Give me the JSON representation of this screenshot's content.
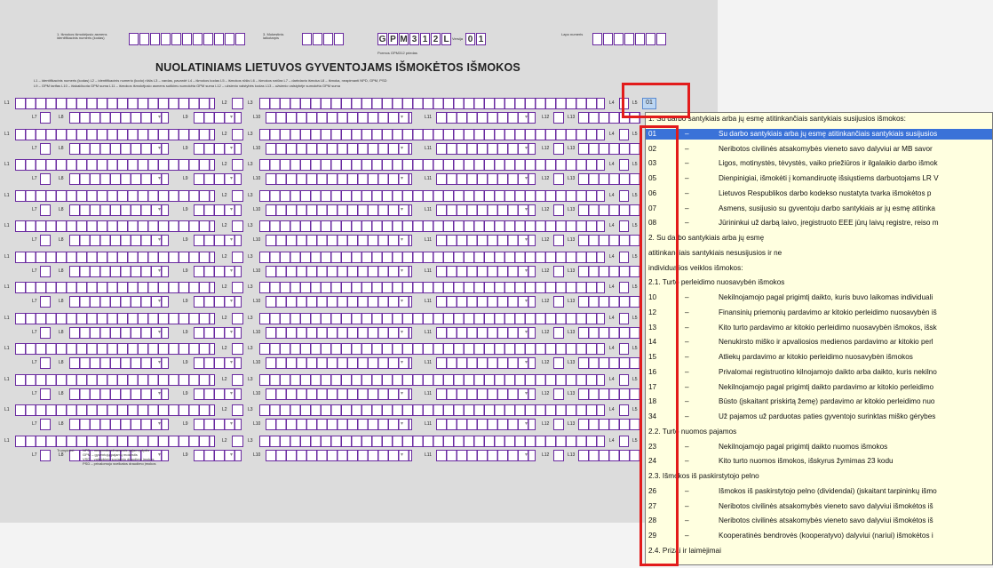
{
  "header": {
    "field1_label": "1. Išmokos išmokėjusio asmens identifikacinis numeris (kodas)",
    "field2_label": "3. Mokestinis laikotarpis",
    "form_code": [
      "G",
      "P",
      "M",
      "3",
      "1",
      "2",
      "L"
    ],
    "version_label": "Versija",
    "version_value": [
      "0",
      "1"
    ],
    "form_subtitle": "Pormos GPM312 priedas",
    "page_label": "Lapo numeris",
    "title": "NUOLATINIAMS LIETUVOS GYVENTOJAMS IŠMOKĖTOS IŠMOKOS",
    "legend_line1": "L1 – identifikacinis numeris (kodas)  L2 – identifikacinis numerio (kodo) rūšis  L3 – vardas, pavardė  L4 – išmokos kodas  L5 – išmokos rūšis  L6 – išmokos natūra  L7 – darbdavio išmoka  L8 – išmoka, neapimanti NPD, GPM, PSD",
    "legend_line2": "L9 – GPM tarifas  L10 – išskaičiuota GPM suma  L11 – išmokos išmokėjusio asmens sutikimu sumokėta GPM suma  L12 – užsienio valstybės kodas  L13 – užsienio valstybėje sumokėta GPM suma"
  },
  "row_labels": {
    "l1": "L1",
    "l2": "L2",
    "l3": "L3",
    "l4": "L4",
    "l5": "L5",
    "l7": "L7",
    "l8": "L8",
    "l9": "L9",
    "l10": "L10",
    "l11": "L11",
    "l12": "L12",
    "l13": "L13"
  },
  "footnote": {
    "title": "Trumpiniai:",
    "line1": "NPD – neapmokestinamasis pajamų dydis",
    "line2": "GPM – gyventojų pajamų mokestis",
    "line3": "VSD – valstybinio socialinio draudimo įmokos",
    "line4": "PSD – privalomojo sveikatos draudimo įmokos"
  },
  "selected_cell_text": "01",
  "popup": {
    "items": [
      {
        "type": "header",
        "text": "1. Su darbo santykiais arba jų esmę atitinkančiais santykiais susijusios išmokos:"
      },
      {
        "type": "item",
        "code": "01",
        "desc": "Su darbo santykiais arba jų esmę atitinkančiais santykiais susijusios"
      },
      {
        "type": "item",
        "code": "02",
        "desc": "Neribotos civilinės atsakomybės vieneto savo dalyviui ar MB savor"
      },
      {
        "type": "item",
        "code": "03",
        "desc": "Ligos, motinystės, tėvystės, vaiko priežiūros ir ilgalaikio darbo išmok"
      },
      {
        "type": "item",
        "code": "05",
        "desc": "Dienpinigiai, išmokėti į komandiruotę išsiųstiems darbuotojams LR V"
      },
      {
        "type": "item",
        "code": "06",
        "desc": "Lietuvos Respublikos darbo kodekso nustatyta tvarka išmokėtos p"
      },
      {
        "type": "item",
        "code": "07",
        "desc": "Asmens, susijusio su gyventoju darbo santykiais ar jų esmę atitinka"
      },
      {
        "type": "item",
        "code": "08",
        "desc": "Jūrininkui už darbą laivo, įregistruoto EEE jūrų laivų registre, reiso m"
      },
      {
        "type": "header",
        "text": "2. Su darbo santykiais arba jų esmę"
      },
      {
        "type": "header",
        "text": "atitinkančiais santykiais nesusijusios ir ne"
      },
      {
        "type": "header",
        "text": "individualios veiklos išmokos:"
      },
      {
        "type": "header",
        "text": "2.1. Turto perleidimo nuosavybėn išmokos"
      },
      {
        "type": "item",
        "code": "10",
        "desc": "Nekilnojamojo pagal prigimtį daikto, kuris buvo laikomas individuali"
      },
      {
        "type": "item",
        "code": "12",
        "desc": "Finansinių priemonių pardavimo ar kitokio perleidimo nuosavybėn iš"
      },
      {
        "type": "item",
        "code": "13",
        "desc": "Kito turto pardavimo ar kitokio perleidimo nuosavybėn išmokos, išsk"
      },
      {
        "type": "item",
        "code": "14",
        "desc": "Nenukirsto miško ir apvaliosios medienos pardavimo ar kitokio perl"
      },
      {
        "type": "item",
        "code": "15",
        "desc": "Atliekų pardavimo ar kitokio perleidimo nuosavybėn išmokos"
      },
      {
        "type": "item",
        "code": "16",
        "desc": "Privalomai registruotino kilnojamojo daikto arba daikto, kuris nekilno"
      },
      {
        "type": "item",
        "code": "17",
        "desc": "Nekilnojamojo pagal prigimtį daikto pardavimo ar kitokio perleidimo"
      },
      {
        "type": "item",
        "code": "18",
        "desc": "Būsto (įskaitant priskirtą žemę) pardavimo ar kitokio perleidimo nuo"
      },
      {
        "type": "item",
        "code": "34",
        "desc": "Už pajamos už parduotas paties gyventojo surinktas miško gėrybes"
      },
      {
        "type": "header",
        "text": "2.2. Turto nuomos pajamos"
      },
      {
        "type": "item",
        "code": "23",
        "desc": "Nekilnojamojo pagal prigimtį daikto nuomos išmokos"
      },
      {
        "type": "item",
        "code": "24",
        "desc": "Kito turto nuomos išmokos, išskyrus žymimas 23 kodu"
      },
      {
        "type": "header",
        "text": "2.3. Išmokos iš paskirstytojo pelno"
      },
      {
        "type": "item",
        "code": "26",
        "desc": "Išmokos iš paskirstytojo pelno (dividendai) (įskaitant tarpininkų išmo"
      },
      {
        "type": "item",
        "code": "27",
        "desc": "Neribotos civilinės atsakomybės vieneto savo dalyviui išmokėtos iš"
      },
      {
        "type": "item",
        "code": "28",
        "desc": "Neribotos civilinės atsakomybės vieneto savo dalyviui išmokėtos iš"
      },
      {
        "type": "item",
        "code": "29",
        "desc": "Kooperatinės bendrovės (kooperatyvo) dalyviui (nariui) išmokėtos i"
      },
      {
        "type": "header",
        "text": "2.4. Prizai ir laimėjimai"
      }
    ]
  }
}
